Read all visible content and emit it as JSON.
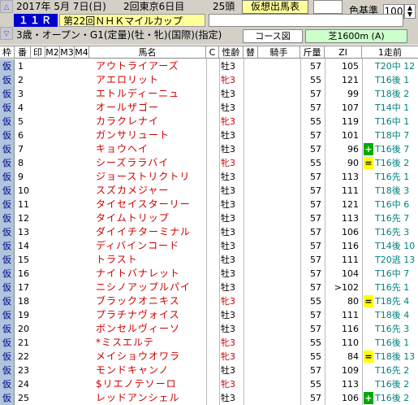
{
  "header": {
    "date": "2017年 5月 7日(日)",
    "meeting": "2回東京6日目",
    "runners": "25頭",
    "card_button": "仮想出馬表",
    "race_no": "１１Ｒ",
    "race_name": "第22回ＮＨＫマイルカップ",
    "conditions": "3歳・オープン・G1(定量)(牡・牝)(国際)(指定)",
    "color_threshold_label": "色基準",
    "color_threshold_value": "100",
    "course_label": "コース図",
    "course_value": "芝1600m (A)",
    "up_arrow": "△",
    "down_arrow": "▽"
  },
  "columns": [
    "枠",
    "番",
    "印",
    "M2",
    "M3",
    "M4",
    "馬名",
    "C",
    "性齢",
    "替",
    "騎手",
    "斤量",
    "ZI",
    "1走前"
  ],
  "rows": [
    {
      "frame": "仮",
      "no": "1",
      "name": "アウトライアーズ",
      "sexage": "牡3",
      "weight": "57",
      "zi": "105",
      "mark": "",
      "last": "T20中 12"
    },
    {
      "frame": "仮",
      "no": "2",
      "name": "アエロリット",
      "sexage": "牝3",
      "weight": "55",
      "zi": "121",
      "mark": "",
      "last": "T16後 1"
    },
    {
      "frame": "仮",
      "no": "3",
      "name": "エトルディーニュ",
      "sexage": "牡3",
      "weight": "57",
      "zi": "99",
      "mark": "",
      "last": "T18後 2"
    },
    {
      "frame": "仮",
      "no": "4",
      "name": "オールザゴー",
      "sexage": "牡3",
      "weight": "57",
      "zi": "107",
      "mark": "",
      "last": "T14中 1"
    },
    {
      "frame": "仮",
      "no": "5",
      "name": "カラクレナイ",
      "sexage": "牝3",
      "weight": "55",
      "zi": "119",
      "mark": "",
      "last": "T16中 1"
    },
    {
      "frame": "仮",
      "no": "6",
      "name": "ガンサリュート",
      "sexage": "牡3",
      "weight": "57",
      "zi": "101",
      "mark": "",
      "last": "T18中 7"
    },
    {
      "frame": "仮",
      "no": "7",
      "name": "キョウヘイ",
      "sexage": "牡3",
      "weight": "57",
      "zi": "96",
      "mark": "+",
      "last": "T16後 7"
    },
    {
      "frame": "仮",
      "no": "8",
      "name": "シーズララバイ",
      "sexage": "牝3",
      "weight": "55",
      "zi": "90",
      "mark": "=",
      "last": "T16後 2"
    },
    {
      "frame": "仮",
      "no": "9",
      "name": "ジョーストリクトリ",
      "sexage": "牡3",
      "weight": "57",
      "zi": "113",
      "mark": "",
      "last": "T16先 1"
    },
    {
      "frame": "仮",
      "no": "10",
      "name": "スズカメジャー",
      "sexage": "牡3",
      "weight": "57",
      "zi": "111",
      "mark": "",
      "last": "T18後 3"
    },
    {
      "frame": "仮",
      "no": "11",
      "name": "タイセイスターリー",
      "sexage": "牡3",
      "weight": "57",
      "zi": "121",
      "mark": "",
      "last": "T16中 6"
    },
    {
      "frame": "仮",
      "no": "12",
      "name": "タイムトリップ",
      "sexage": "牡3",
      "weight": "57",
      "zi": "113",
      "mark": "",
      "last": "T16先 7"
    },
    {
      "frame": "仮",
      "no": "13",
      "name": "ダイイチターミナル",
      "sexage": "牡3",
      "weight": "57",
      "zi": "106",
      "mark": "",
      "last": "T16先 3"
    },
    {
      "frame": "仮",
      "no": "14",
      "name": "ディバインコード",
      "sexage": "牡3",
      "weight": "57",
      "zi": "116",
      "mark": "",
      "last": "T14後 10"
    },
    {
      "frame": "仮",
      "no": "15",
      "name": "トラスト",
      "sexage": "牡3",
      "weight": "57",
      "zi": "111",
      "mark": "",
      "last": "T20逃 13"
    },
    {
      "frame": "仮",
      "no": "16",
      "name": "ナイトバナレット",
      "sexage": "牡3",
      "weight": "57",
      "zi": "104",
      "mark": "",
      "last": "T16中 7"
    },
    {
      "frame": "仮",
      "no": "17",
      "name": "ニシノアップルパイ",
      "sexage": "牡3",
      "weight": "57",
      "zi": ">102",
      "mark": "",
      "last": "T16先 1"
    },
    {
      "frame": "仮",
      "no": "18",
      "name": "ブラックオニキス",
      "sexage": "牝3",
      "weight": "55",
      "zi": "80",
      "mark": "=",
      "last": "T18先 4"
    },
    {
      "frame": "仮",
      "no": "19",
      "name": "プラチナヴォイス",
      "sexage": "牡3",
      "weight": "57",
      "zi": "111",
      "mark": "",
      "last": "T18後 4"
    },
    {
      "frame": "仮",
      "no": "20",
      "name": "ボンセルヴィーソ",
      "sexage": "牡3",
      "weight": "57",
      "zi": "116",
      "mark": "",
      "last": "T16先 3"
    },
    {
      "frame": "仮",
      "no": "21",
      "name": "*ミスエルテ",
      "sexage": "牝3",
      "weight": "55",
      "zi": "110",
      "mark": "",
      "last": "T16後 1"
    },
    {
      "frame": "仮",
      "no": "22",
      "name": "メイショウオワラ",
      "sexage": "牝3",
      "weight": "55",
      "zi": "84",
      "mark": "=",
      "last": "T18後 13"
    },
    {
      "frame": "仮",
      "no": "23",
      "name": "モンドキャンノ",
      "sexage": "牡3",
      "weight": "57",
      "zi": "109",
      "mark": "",
      "last": "T16先 2"
    },
    {
      "frame": "仮",
      "no": "24",
      "name": "$リエノテソーロ",
      "sexage": "牝3",
      "weight": "55",
      "zi": "113",
      "mark": "",
      "last": "T16後 2"
    },
    {
      "frame": "仮",
      "no": "25",
      "name": "レッドアンシェル",
      "sexage": "牡3",
      "weight": "57",
      "zi": "106",
      "mark": "+",
      "last": "T16後 2"
    }
  ]
}
